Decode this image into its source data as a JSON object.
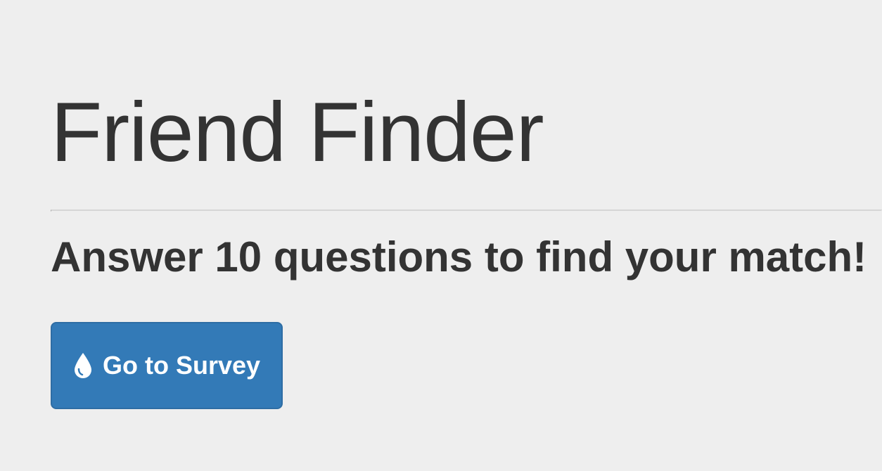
{
  "page": {
    "title": "Friend Finder",
    "tagline": "Answer 10 questions to find your match!"
  },
  "survey_button": {
    "label": "Go to Survey",
    "icon": "tint-icon"
  },
  "colors": {
    "background": "#eeeeee",
    "text": "#333333",
    "button_primary": "#337ab7",
    "button_border": "#2e6da4",
    "button_text": "#ffffff",
    "divider": "#d5d5d5"
  }
}
